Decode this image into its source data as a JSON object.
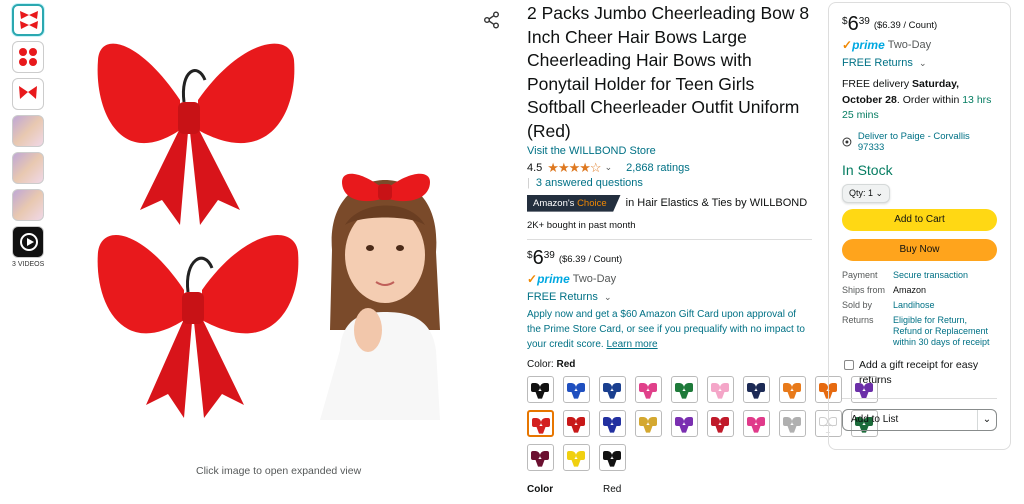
{
  "thumbnails": {
    "video_label": "3 VIDEOS"
  },
  "main_image": {
    "click_hint": "Click image to open expanded view"
  },
  "product": {
    "title": "2 Packs Jumbo Cheerleading Bow 8 Inch Cheer Hair Bows Large Cheerleading Hair Bows with Ponytail Holder for Teen Girls Softball Cheerleader Outfit Uniform (Red)",
    "store_link": "Visit the WILLBOND Store",
    "rating_value": "4.5",
    "stars_glyph": "★★★★☆",
    "ratings_count": "2,868 ratings",
    "answered": "3 answered questions",
    "badge_prefix": "Amazon's ",
    "badge_suffix": "Choice",
    "badge_category": "in Hair Elastics & Ties by WILLBOND",
    "bought": "2K+ bought in past month",
    "price_symbol": "$",
    "price_whole": "6",
    "price_fraction": "39",
    "per_count": "($6.39 / Count)",
    "prime_check": "✓",
    "prime_word": "prime",
    "prime_two_day": "Two-Day",
    "free_returns": "FREE Returns",
    "apply_text": "Apply now and get a $60 Amazon Gift Card upon approval of the Prime Store Card, or see if you prequalify with no impact to your credit score.",
    "learn_more": "Learn more",
    "color_label": "Color:",
    "color_value": "Red",
    "bottom_key": "Color",
    "bottom_value": "Red"
  },
  "swatch_colors": [
    "#111111",
    "#1f4fbf",
    "#1a3f8f",
    "#e0408a",
    "#1e7a3a",
    "#f4a6c8",
    "#1c2a55",
    "#e87a1a",
    "#e66a10",
    "#6b2fa8",
    "#d32020",
    "#c81818",
    "#2230a0",
    "#d4a830",
    "#7a2fb0",
    "#c01a2a",
    "#e03a8a",
    "#b0b0b0",
    "#ffffff",
    "#1b6b3a",
    "#6b1030",
    "#f0d010",
    "#111111"
  ],
  "buybox": {
    "price_symbol": "$",
    "price_whole": "6",
    "price_fraction": "39",
    "per_count": "($6.39 / Count)",
    "prime_check": "✓",
    "prime_word": "prime",
    "prime_two_day": "Two-Day",
    "free_returns": "FREE Returns",
    "free_delivery_pre": "FREE delivery ",
    "delivery_date": "Saturday, October 28",
    "order_within_pre": ". Order within ",
    "order_within": "13 hrs 25 mins",
    "deliver_to": "Deliver to Paige - Corvallis 97333",
    "in_stock": "In Stock",
    "qty": "Qty: 1",
    "add_to_cart": "Add to Cart",
    "buy_now": "Buy Now",
    "payment_k": "Payment",
    "payment_v": "Secure transaction",
    "ships_k": "Ships from",
    "ships_v": "Amazon",
    "sold_k": "Sold by",
    "sold_v": "Landihose",
    "returns_k": "Returns",
    "returns_v": "Eligible for Return, Refund or Replacement within 30 days of receipt",
    "gift_receipt": "Add a gift receipt for easy returns",
    "add_to_list": "Add to List"
  },
  "colors": {
    "link": "#007185",
    "star": "#de7921",
    "prime": "#00a8e1",
    "cart_button": "#ffd814",
    "buy_button": "#ffa41c",
    "in_stock": "#067d62",
    "bow_red": "#e8191c"
  }
}
